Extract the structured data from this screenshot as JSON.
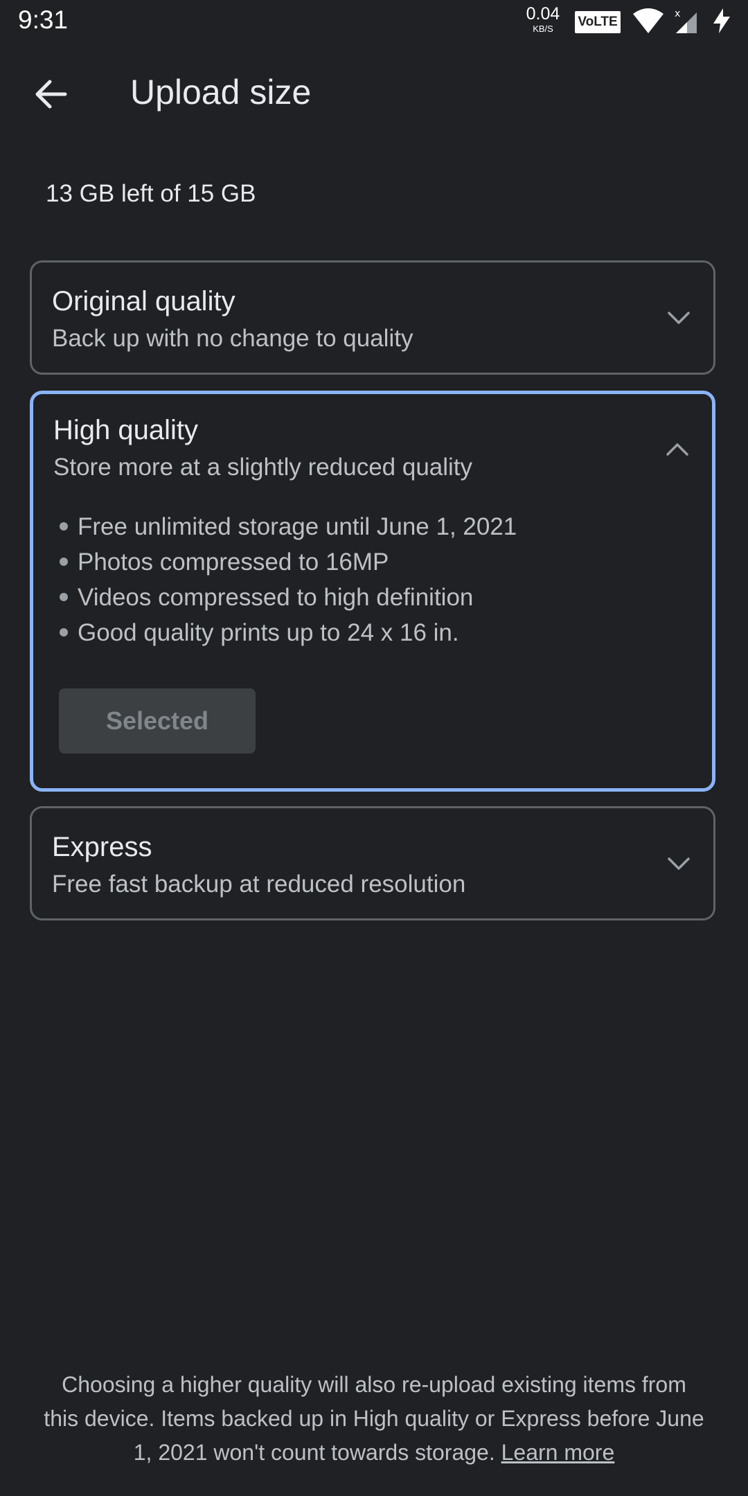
{
  "status_bar": {
    "time": "9:31",
    "net_speed": "0.04",
    "net_speed_unit": "KB/S",
    "volte": "VoLTE"
  },
  "app_bar": {
    "title": "Upload size"
  },
  "storage": {
    "text": "13 GB left of 15 GB"
  },
  "options": {
    "original": {
      "title": "Original quality",
      "subtitle": "Back up with no change to quality"
    },
    "high": {
      "title": "High quality",
      "subtitle": "Store more at a slightly reduced quality",
      "bullets": [
        "Free unlimited storage until June 1, 2021",
        "Photos compressed to 16MP",
        "Videos compressed to high definition",
        "Good quality prints up to 24 x 16 in."
      ],
      "button_label": "Selected"
    },
    "express": {
      "title": "Express",
      "subtitle": "Free fast backup at reduced resolution"
    }
  },
  "footer": {
    "text": "Choosing a higher quality will also re-upload existing items from this device. Items backed up in High quality or Express before June 1, 2021 won't count towards storage.",
    "link": "Learn more"
  },
  "colors": {
    "background": "#202124",
    "selected_border": "#8ab4f8",
    "card_border": "#5f6368"
  }
}
